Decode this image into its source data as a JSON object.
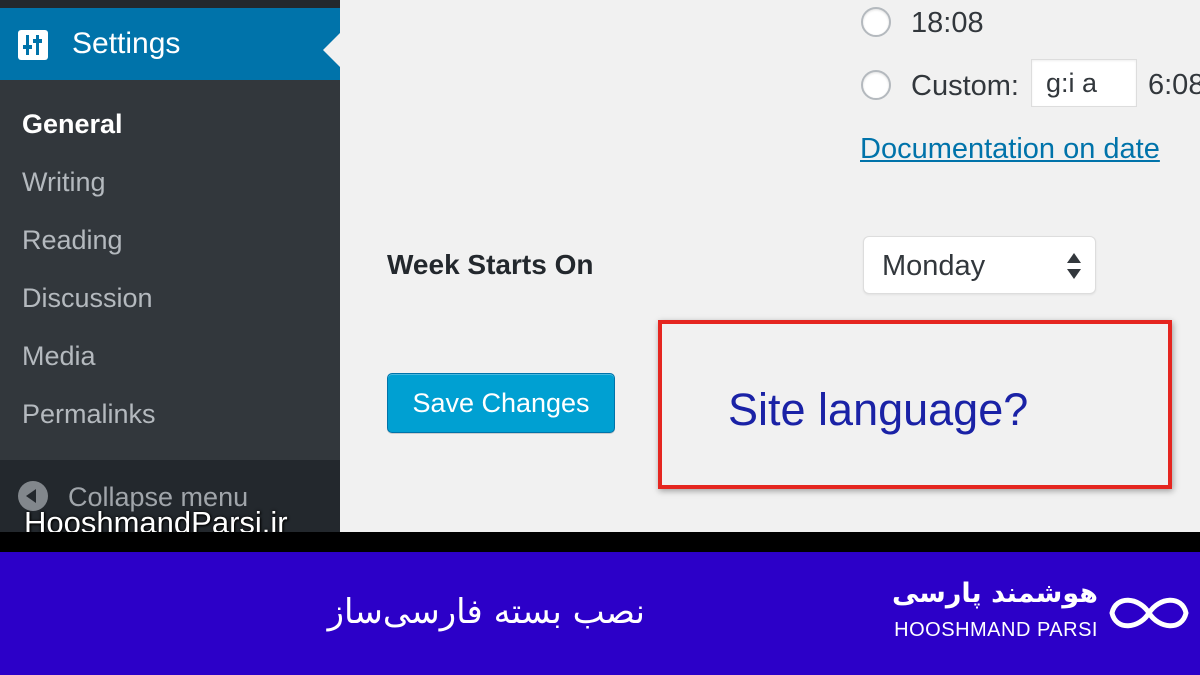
{
  "sidebar": {
    "settings_label": "Settings",
    "settings_icon": "sliders-icon",
    "items": [
      {
        "label": "General",
        "current": true
      },
      {
        "label": "Writing",
        "current": false
      },
      {
        "label": "Reading",
        "current": false
      },
      {
        "label": "Discussion",
        "current": false
      },
      {
        "label": "Media",
        "current": false
      },
      {
        "label": "Permalinks",
        "current": false
      }
    ],
    "collapse_label": "Collapse menu"
  },
  "watermark": "HooshmandParsi.ir",
  "time_format": {
    "option_1": "18:08",
    "custom_label": "Custom:",
    "custom_value": "g:i a",
    "custom_example": "6:08",
    "doc_link": "Documentation on date"
  },
  "week": {
    "label": "Week Starts On",
    "selected": "Monday"
  },
  "save_button": "Save Changes",
  "annotation": "Site language?",
  "footer": {
    "title": "نصب بسته فارسی‌ساز",
    "brand_fa": "هوشمند پارسی",
    "brand_en": "HOOSHMAND PARSI"
  },
  "colors": {
    "accent": "#0073aa",
    "button": "#00a0d2",
    "highlight_border": "#e52620",
    "footer_bg": "#2c00c8"
  }
}
